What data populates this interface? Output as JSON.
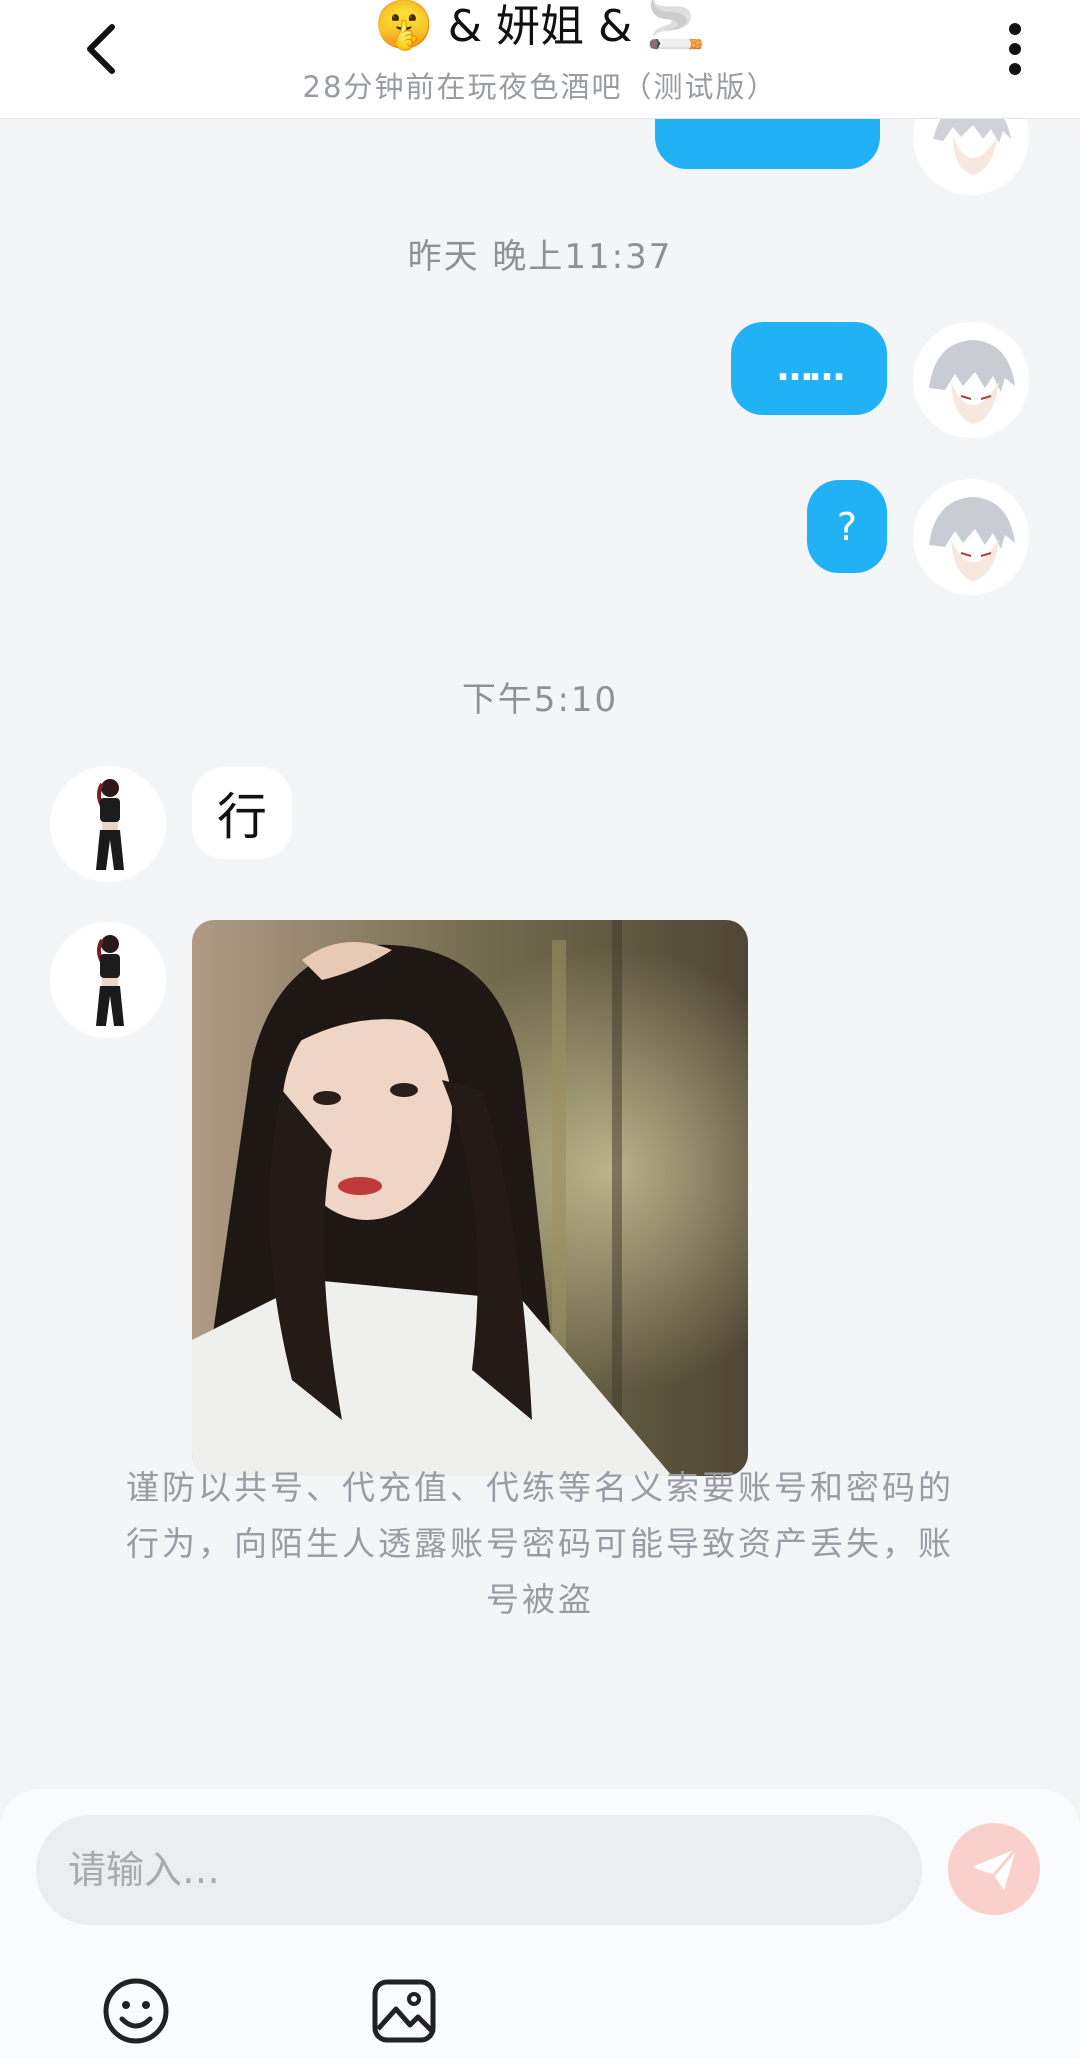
{
  "header": {
    "title_emoji_left": "🤫",
    "title_text": " & 妍姐 & ",
    "title_emoji_right": "🚬",
    "subtitle": "28分钟前在玩夜色酒吧（测试版）"
  },
  "messages": {
    "timestamp_1": "昨天 晚上11:37",
    "out_1": "……",
    "out_2": "?",
    "timestamp_2": "下午5:10",
    "in_1": "行"
  },
  "notice": "谨防以共号、代充值、代练等名义索要账号和密码的行为，向陌生人透露账号密码可能导致资产丢失，账号被盗",
  "input": {
    "placeholder": "请输入…"
  },
  "colors": {
    "accent": "#20b2f5",
    "send_disabled": "#f9d0cc",
    "background": "#f4f5f7"
  },
  "icons": [
    "back-arrow-icon",
    "more-vertical-icon",
    "send-icon",
    "emoji-icon",
    "image-icon"
  ]
}
